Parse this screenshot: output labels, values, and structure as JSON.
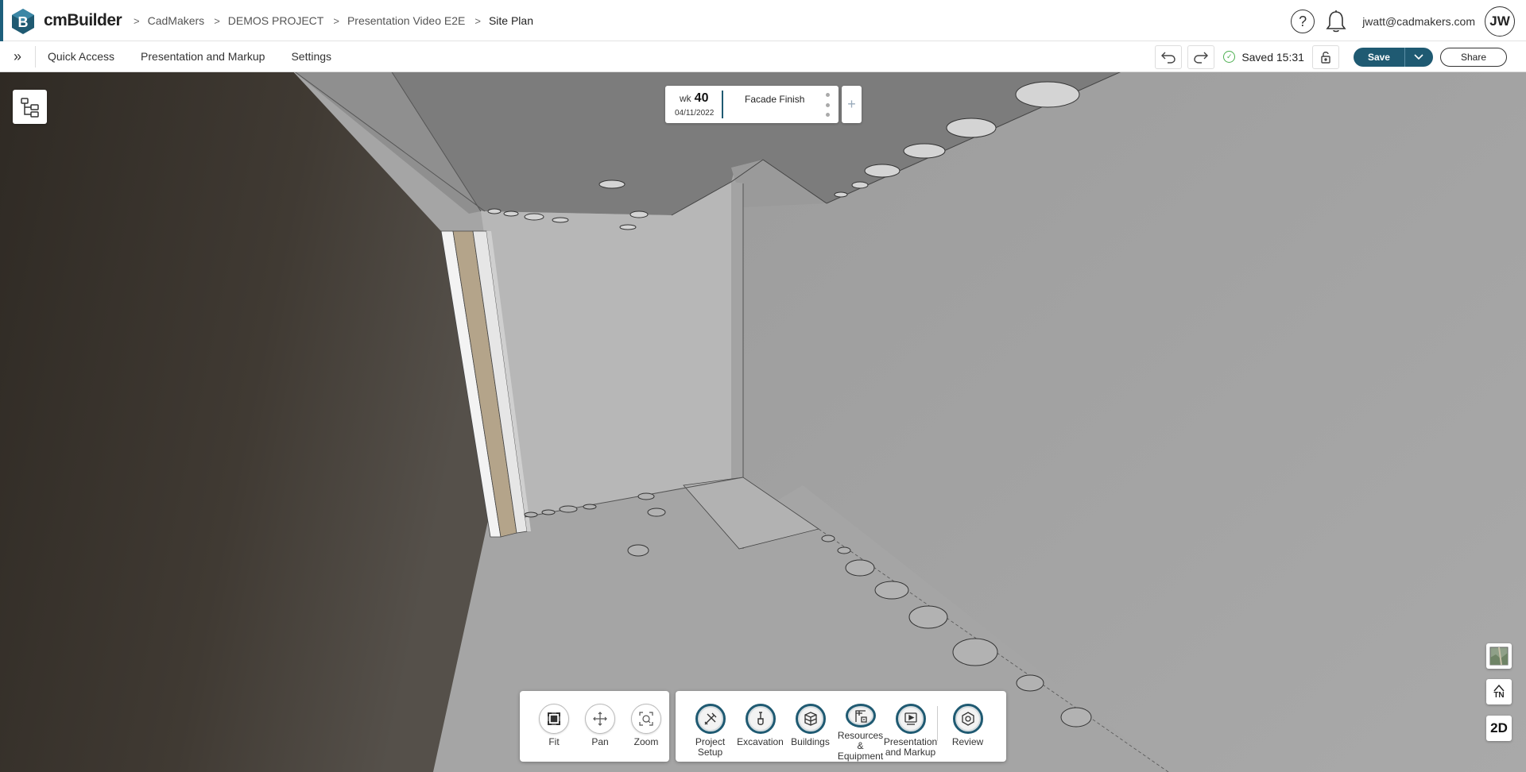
{
  "app": {
    "name": "cmBuilder",
    "logo_letter": "B",
    "brand_color": "#1f5a72"
  },
  "breadcrumb": [
    "CadMakers",
    "DEMOS PROJECT",
    "Presentation Video E2E",
    "Site Plan"
  ],
  "header": {
    "help_icon": "question-circle-icon",
    "notification_icon": "bell-icon",
    "user_email": "jwatt@cadmakers.com",
    "avatar_initials": "JW"
  },
  "toolbar": {
    "menu": [
      "Quick Access",
      "Presentation and Markup",
      "Settings"
    ],
    "saved_text": "Saved 15:31",
    "save_label": "Save",
    "share_label": "Share"
  },
  "timeline": {
    "week_prefix": "wk",
    "week_number": "40",
    "date": "04/11/2022",
    "phase": "Facade Finish",
    "add_label": "+"
  },
  "nav_tools": [
    {
      "label": "Fit",
      "icon": "fit-icon"
    },
    {
      "label": "Pan",
      "icon": "pan-icon"
    },
    {
      "label": "Zoom",
      "icon": "zoom-icon"
    }
  ],
  "module_tools": [
    {
      "label": "Project\nSetup",
      "icon": "project-setup-icon"
    },
    {
      "label": "Excavation",
      "icon": "excavation-icon"
    },
    {
      "label": "Buildings",
      "icon": "buildings-icon"
    },
    {
      "label": "Resources &\nEquipment",
      "icon": "resources-equipment-icon"
    },
    {
      "label": "Presentation\nand Markup",
      "icon": "presentation-markup-icon"
    },
    {
      "label": "Review",
      "icon": "review-icon"
    }
  ],
  "side_controls": {
    "north_label": "TN",
    "view_mode": "2D"
  },
  "colors": {
    "accent": "#1f5a72",
    "saved_check": "#4caf50"
  }
}
